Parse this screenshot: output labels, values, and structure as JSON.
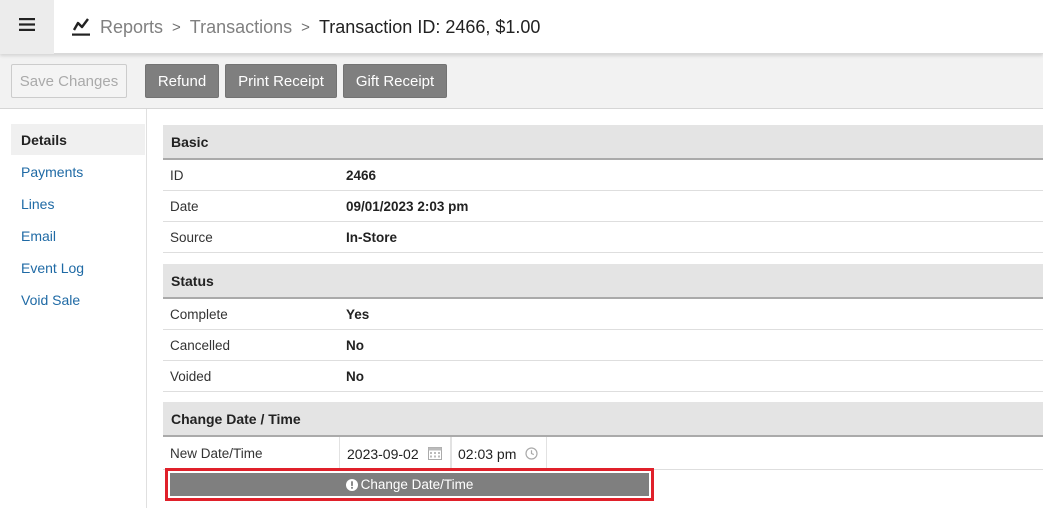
{
  "topbar": {
    "menu_icon": "hamburger-icon",
    "reports_icon": "line-chart-icon",
    "breadcrumb": {
      "reports": "Reports",
      "transactions": "Transactions",
      "current": "Transaction ID: 2466, $1.00",
      "separator": ">"
    }
  },
  "toolbar": {
    "save_label": "Save Changes",
    "refund_label": "Refund",
    "print_label": "Print Receipt",
    "gift_label": "Gift Receipt"
  },
  "sidebar": {
    "items": [
      {
        "label": "Details",
        "active": true
      },
      {
        "label": "Payments",
        "active": false
      },
      {
        "label": "Lines",
        "active": false
      },
      {
        "label": "Email",
        "active": false
      },
      {
        "label": "Event Log",
        "active": false
      },
      {
        "label": "Void Sale",
        "active": false
      }
    ]
  },
  "basic": {
    "title": "Basic",
    "id_label": "ID",
    "id_value": "2466",
    "date_label": "Date",
    "date_value": "09/01/2023 2:03 pm",
    "source_label": "Source",
    "source_value": "In-Store"
  },
  "status": {
    "title": "Status",
    "complete_label": "Complete",
    "complete_value": "Yes",
    "cancelled_label": "Cancelled",
    "cancelled_value": "No",
    "voided_label": "Voided",
    "voided_value": "No"
  },
  "change": {
    "title": "Change Date / Time",
    "new_label": "New Date/Time",
    "date_value": "2023-09-02",
    "time_value": "02:03 pm",
    "button_label": "Change Date/Time"
  },
  "colors": {
    "button_gray": "#7f7f7f",
    "link_blue": "#1f6aa5",
    "highlight_red": "#e0202a"
  }
}
